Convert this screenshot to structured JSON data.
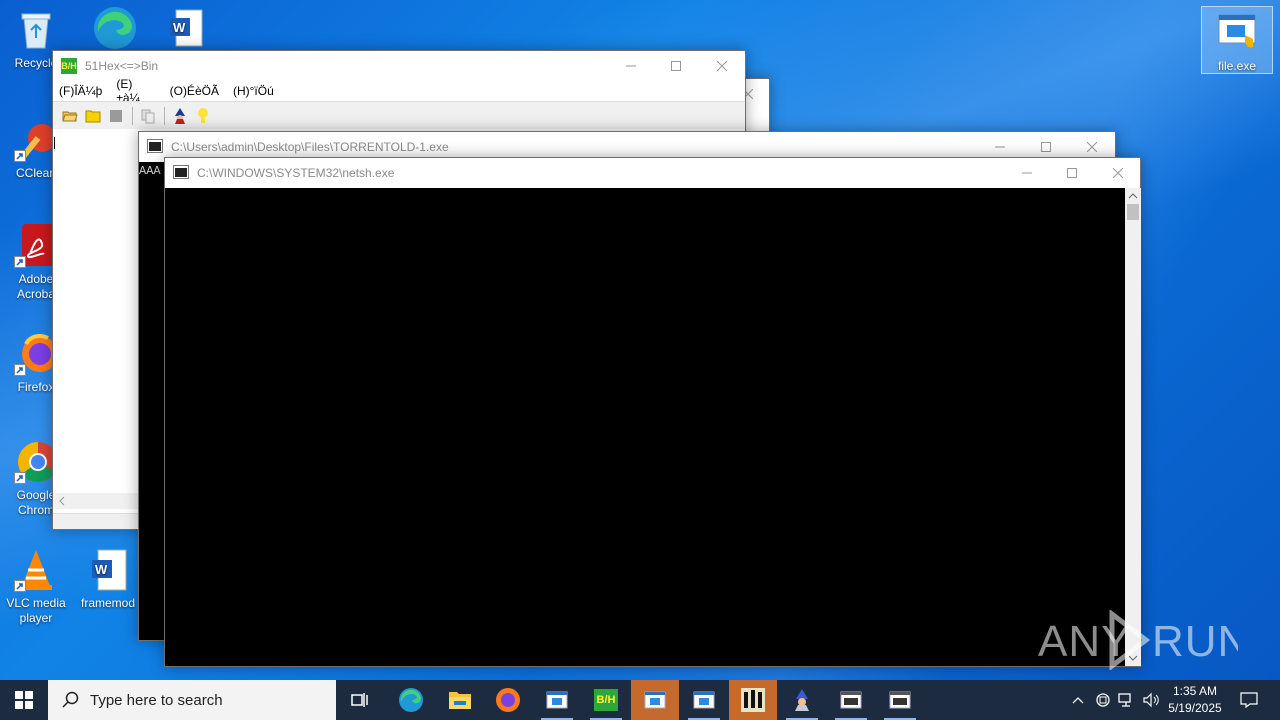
{
  "desktop": {
    "icons": [
      {
        "label": "Recycle"
      },
      {
        "label": "CClean"
      },
      {
        "label": "Adobe Acroba"
      },
      {
        "label": "Firefox"
      },
      {
        "label": "Google Chrom"
      },
      {
        "label": "VLC media player"
      },
      {
        "label": "framemod"
      },
      {
        "label": "file.exe"
      }
    ]
  },
  "hex_window": {
    "title": "51Hex<=>Bin",
    "icon_text": "B/H",
    "menu": [
      "(F)ÎÄ¼þ",
      "(E)±à¼­",
      "(O)ÉèÖÃ",
      "(H)°ïÖú"
    ]
  },
  "torrent_window": {
    "title": "C:\\Users\\admin\\Desktop\\Files\\TORRENTOLD-1.exe",
    "console_text": "AAA"
  },
  "netsh_window": {
    "title": "C:\\WINDOWS\\SYSTEM32\\netsh.exe"
  },
  "taskbar": {
    "search_placeholder": "Type here to search",
    "time": "1:35 AM",
    "date": "5/19/2025",
    "pinned": [
      "task-view",
      "edge",
      "file-explorer",
      "firefox",
      "app-window",
      "hex-bin",
      "app-window-active",
      "app-window",
      "app-tool",
      "app-tool2",
      "app-window",
      "app-window"
    ]
  },
  "watermark": {
    "text": "ANY RUN"
  },
  "colors": {
    "taskbar_bg": "#1c2b3f",
    "active_task_bg": "#c56a2c",
    "console_bg": "#000000",
    "desktop_bg": "#0b6fd9"
  }
}
